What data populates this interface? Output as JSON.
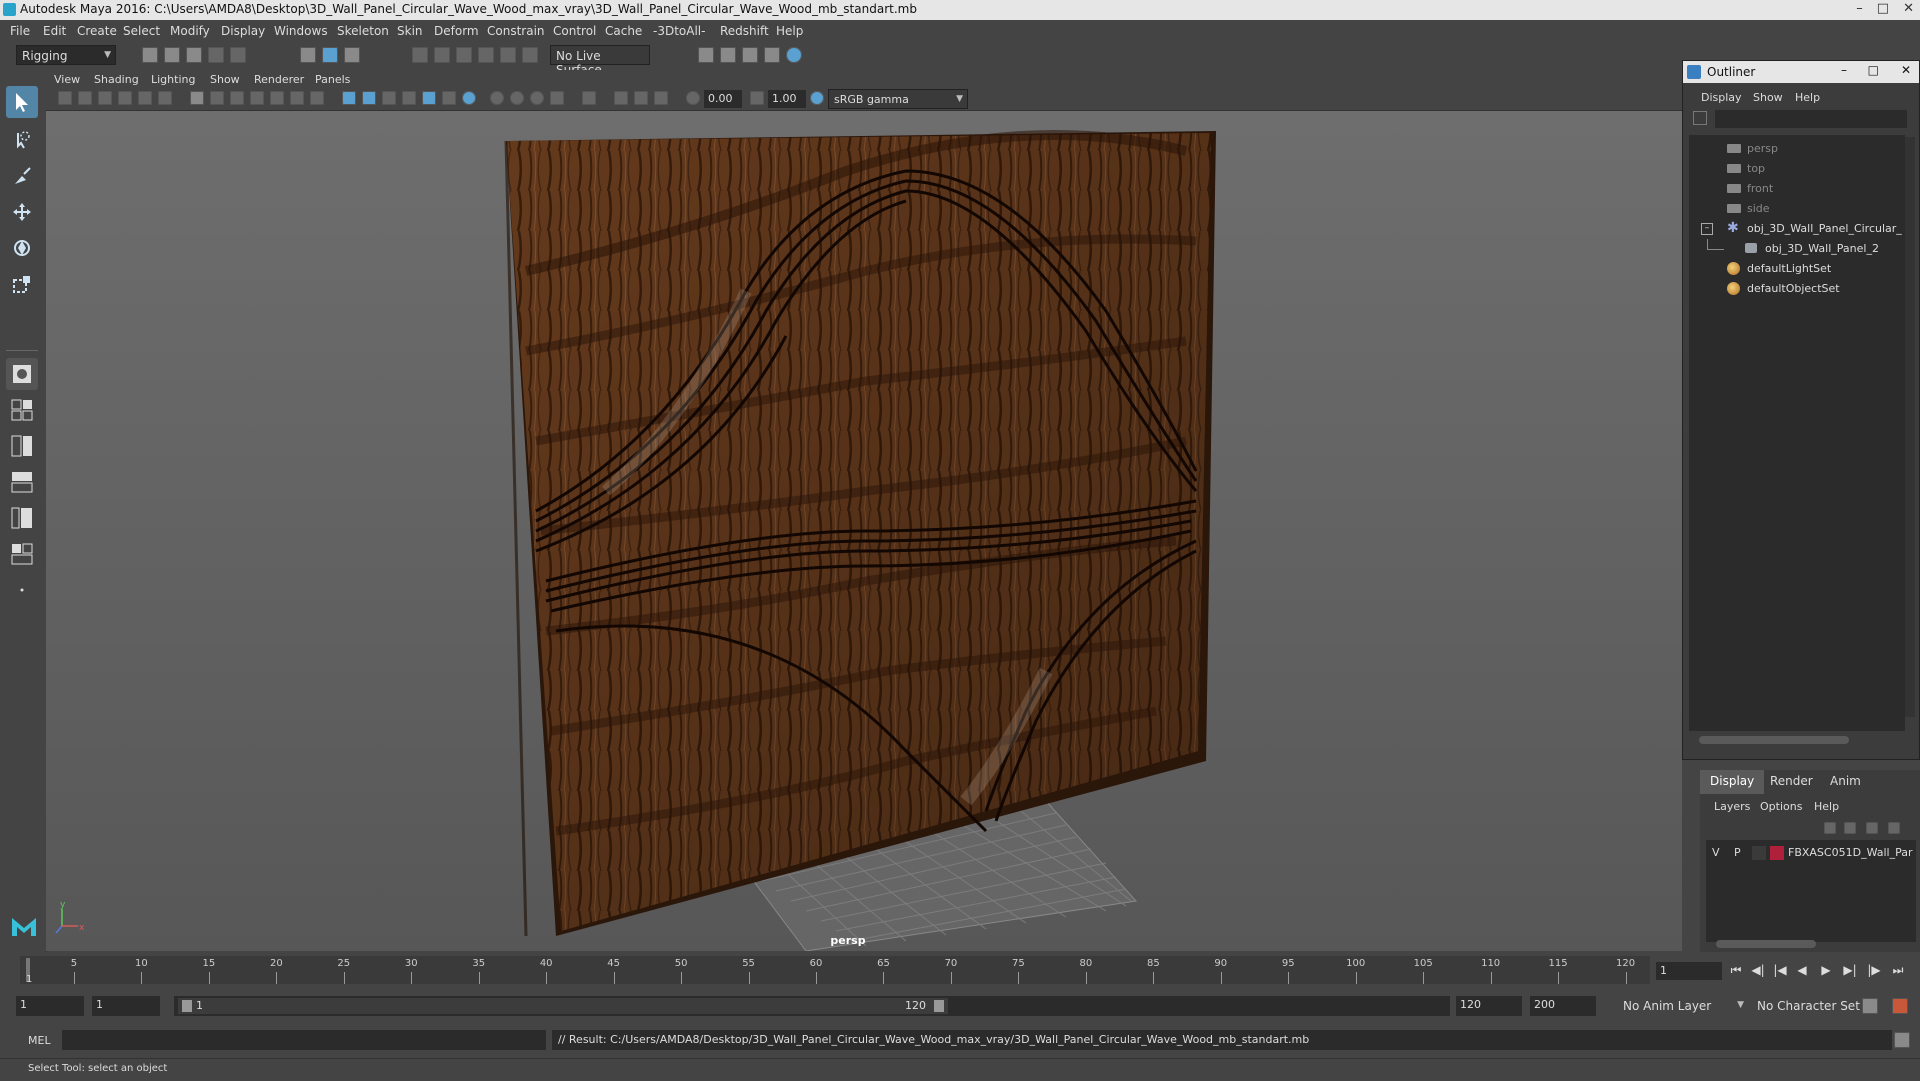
{
  "window": {
    "title": "Autodesk Maya 2016: C:\\Users\\AMDA8\\Desktop\\3D_Wall_Panel_Circular_Wave_Wood_max_vray\\3D_Wall_Panel_Circular_Wave_Wood_mb_standart.mb"
  },
  "menubar": [
    "File",
    "Edit",
    "Create",
    "Select",
    "Modify",
    "Display",
    "Windows",
    "Skeleton",
    "Skin",
    "Deform",
    "Constrain",
    "Control",
    "Cache",
    "-3DtoAll-",
    "Redshift",
    "Help"
  ],
  "status_line": {
    "mode": "Rigging",
    "live_surface": "No Live Surface"
  },
  "panel_menu": [
    "View",
    "Shading",
    "Lighting",
    "Show",
    "Renderer",
    "Panels"
  ],
  "panel_toolbar": {
    "exposure": "0.00",
    "gamma": "1.00",
    "color_space": "sRGB gamma"
  },
  "viewport": {
    "camera_label": "persp",
    "axis_x": "x",
    "axis_y": "y"
  },
  "outliner": {
    "title": "Outliner",
    "menu": [
      "Display",
      "Show",
      "Help"
    ],
    "items": [
      {
        "label": "persp",
        "dim": true
      },
      {
        "label": "top",
        "dim": true
      },
      {
        "label": "front",
        "dim": true
      },
      {
        "label": "side",
        "dim": true
      },
      {
        "label": "obj_3D_Wall_Panel_Circular_",
        "dim": false
      },
      {
        "label": "obj_3D_Wall_Panel_2",
        "dim": false
      },
      {
        "label": "defaultLightSet",
        "dim": false
      },
      {
        "label": "defaultObjectSet",
        "dim": false
      }
    ]
  },
  "layer_editor": {
    "tabs": [
      "Display",
      "Render",
      "Anim"
    ],
    "menu": [
      "Layers",
      "Options",
      "Help"
    ],
    "layer": {
      "v": "V",
      "p": "P",
      "name": "FBXASC051D_Wall_Par",
      "color": "#b0203a"
    }
  },
  "timeline": {
    "ticks": [
      "5",
      "10",
      "15",
      "20",
      "25",
      "30",
      "35",
      "40",
      "45",
      "50",
      "55",
      "60",
      "65",
      "70",
      "75",
      "80",
      "85",
      "90",
      "95",
      "100",
      "105",
      "110",
      "115",
      "120"
    ],
    "start_marker": "1",
    "current_frame": "1"
  },
  "range": {
    "start": "1",
    "playback_start": "1",
    "slider_start": "1",
    "slider_end": "120",
    "playback_end": "120",
    "end": "200",
    "anim_layer": "No Anim Layer",
    "character_set": "No Character Set"
  },
  "command_line": {
    "lang": "MEL",
    "result": "// Result: C:/Users/AMDA8/Desktop/3D_Wall_Panel_Circular_Wave_Wood_max_vray/3D_Wall_Panel_Circular_Wave_Wood_mb_standart.mb"
  },
  "help_line": "Select Tool: select an object"
}
